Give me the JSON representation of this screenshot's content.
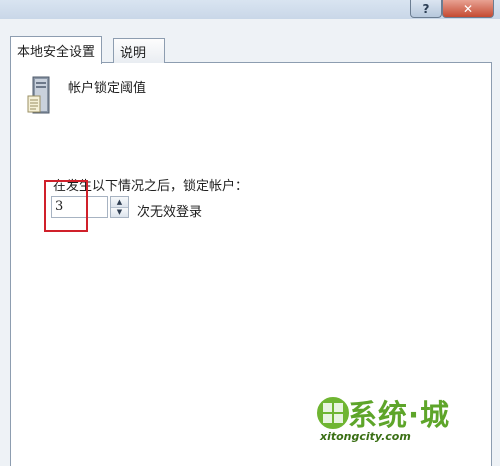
{
  "window": {
    "help_glyph": "?",
    "close_glyph": "✕"
  },
  "tabs": [
    {
      "label": "本地安全设置",
      "active": true
    },
    {
      "label": "说明",
      "active": false
    }
  ],
  "policy": {
    "title": "帐户锁定阈值",
    "icon": "server-icon",
    "instruction": "在发生以下情况之后，锁定帐户：",
    "value": "3",
    "unit_label": "次无效登录"
  },
  "annotation": {
    "color": "#d0202a"
  },
  "watermark": {
    "brand": "系统·城",
    "url": "xitongcity.com",
    "color": "#5ea52a"
  }
}
